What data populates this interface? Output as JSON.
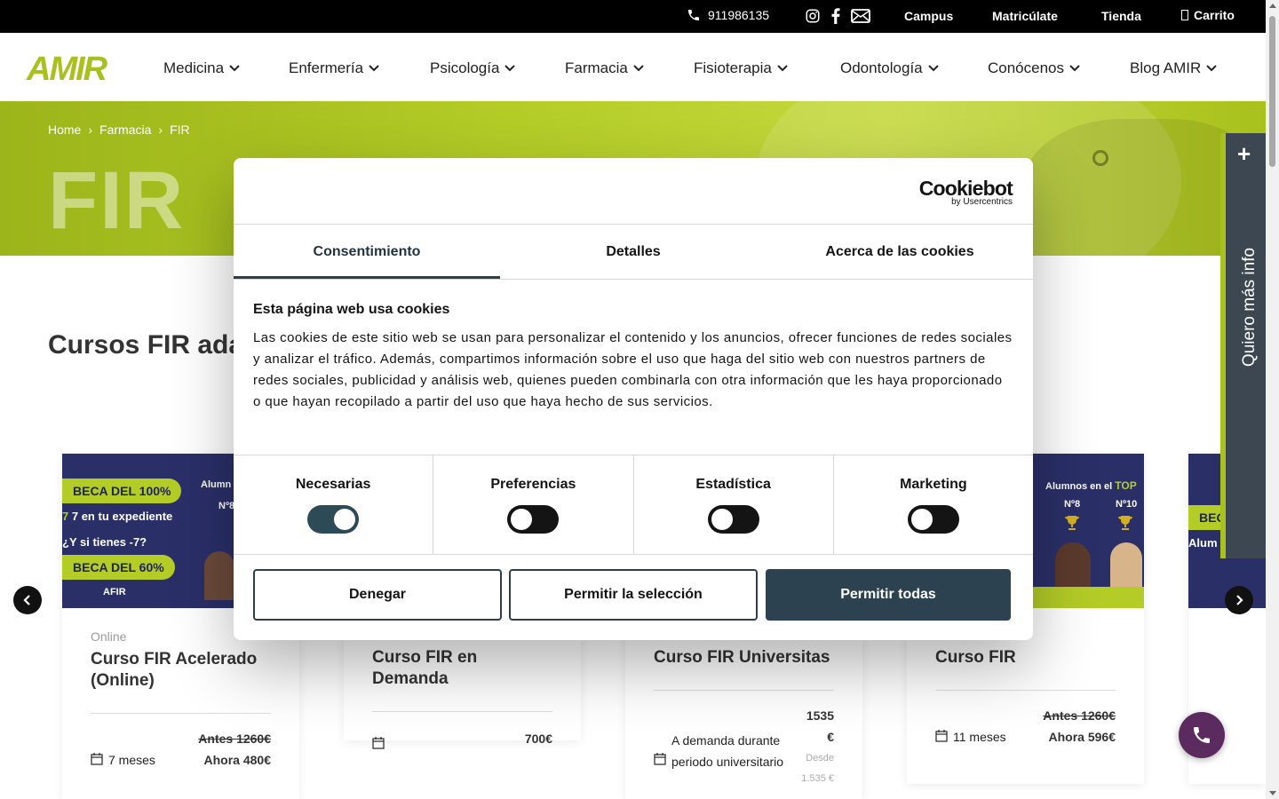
{
  "topbar": {
    "phone": "911986135",
    "links": [
      "Campus",
      "Matricúlate",
      "Tienda",
      "Carrito"
    ],
    "icons": [
      "instagram-icon",
      "facebook-icon",
      "mail-icon"
    ]
  },
  "header": {
    "logo": "AMIR",
    "nav": [
      "Medicina",
      "Enfermería",
      "Psicología",
      "Farmacia",
      "Fisioterapia",
      "Odontología",
      "Conócenos",
      "Blog AMIR"
    ]
  },
  "hero": {
    "breadcrumb": [
      "Home",
      "Farmacia",
      "FIR"
    ],
    "title": "FIR"
  },
  "section": {
    "title": "Cursos FIR ada"
  },
  "cards": [
    {
      "mode": "Online",
      "title": "Curso FIR Acelerado (Online)",
      "duration": "7 meses",
      "price_old": "Antes 1260€",
      "price_now": "Ahora 480€",
      "img": {
        "pill1": "BECA DEL 100%",
        "line1": "7 en tu expediente",
        "line2": "¿Y si tienes -7?",
        "pill2": "BECA DEL 60%",
        "footer": "AFIR",
        "alumni": "Alumn",
        "rank": "Nº8"
      }
    },
    {
      "title": "Curso FIR en Demanda",
      "price_now": "700€"
    },
    {
      "title": "Curso FIR Universitas",
      "duration": "A demanda durante periodo universitario",
      "price_main": "1535",
      "price_currency": "€",
      "price_from": "Desde",
      "price_from_value": "1.535 €"
    },
    {
      "title": "Curso FIR",
      "duration": "11 meses",
      "price_old": "Antes 1260€",
      "price_now": "Ahora 596€",
      "img": {
        "alumni": "Alumnos en el",
        "top": "TOP",
        "rank1": "Nº8",
        "rank2": "Nº10"
      }
    },
    {
      "img": {
        "pill": "BEC",
        "alumni": "Alum"
      }
    }
  ],
  "sidetab": {
    "label": "Quiero más info",
    "plus": "+"
  },
  "cookie": {
    "brand": "Cookiebot",
    "brand_sub": "by Usercentrics",
    "tabs": [
      "Consentimiento",
      "Detalles",
      "Acerca de las cookies"
    ],
    "heading": "Esta página web usa cookies",
    "description": "Las cookies de este sitio web se usan para personalizar el contenido y los anuncios, ofrecer funciones de redes sociales y analizar el tráfico. Además, compartimos información sobre el uso que haga del sitio web con nuestros partners de redes sociales, publicidad y análisis web, quienes pueden combinarla con otra información que les haya proporcionado o que hayan recopilado a partir del uso que haya hecho de sus servicios.",
    "categories": [
      {
        "label": "Necesarias",
        "enabled": true
      },
      {
        "label": "Preferencias",
        "enabled": false
      },
      {
        "label": "Estadística",
        "enabled": false
      },
      {
        "label": "Marketing",
        "enabled": false
      }
    ],
    "buttons": {
      "deny": "Denegar",
      "allow_selection": "Permitir la selección",
      "allow_all": "Permitir todas"
    }
  },
  "colors": {
    "brand": "#a9c11c",
    "dark": "#2d4250",
    "call": "#5b2a5e",
    "card_img": "#2a2f68"
  }
}
